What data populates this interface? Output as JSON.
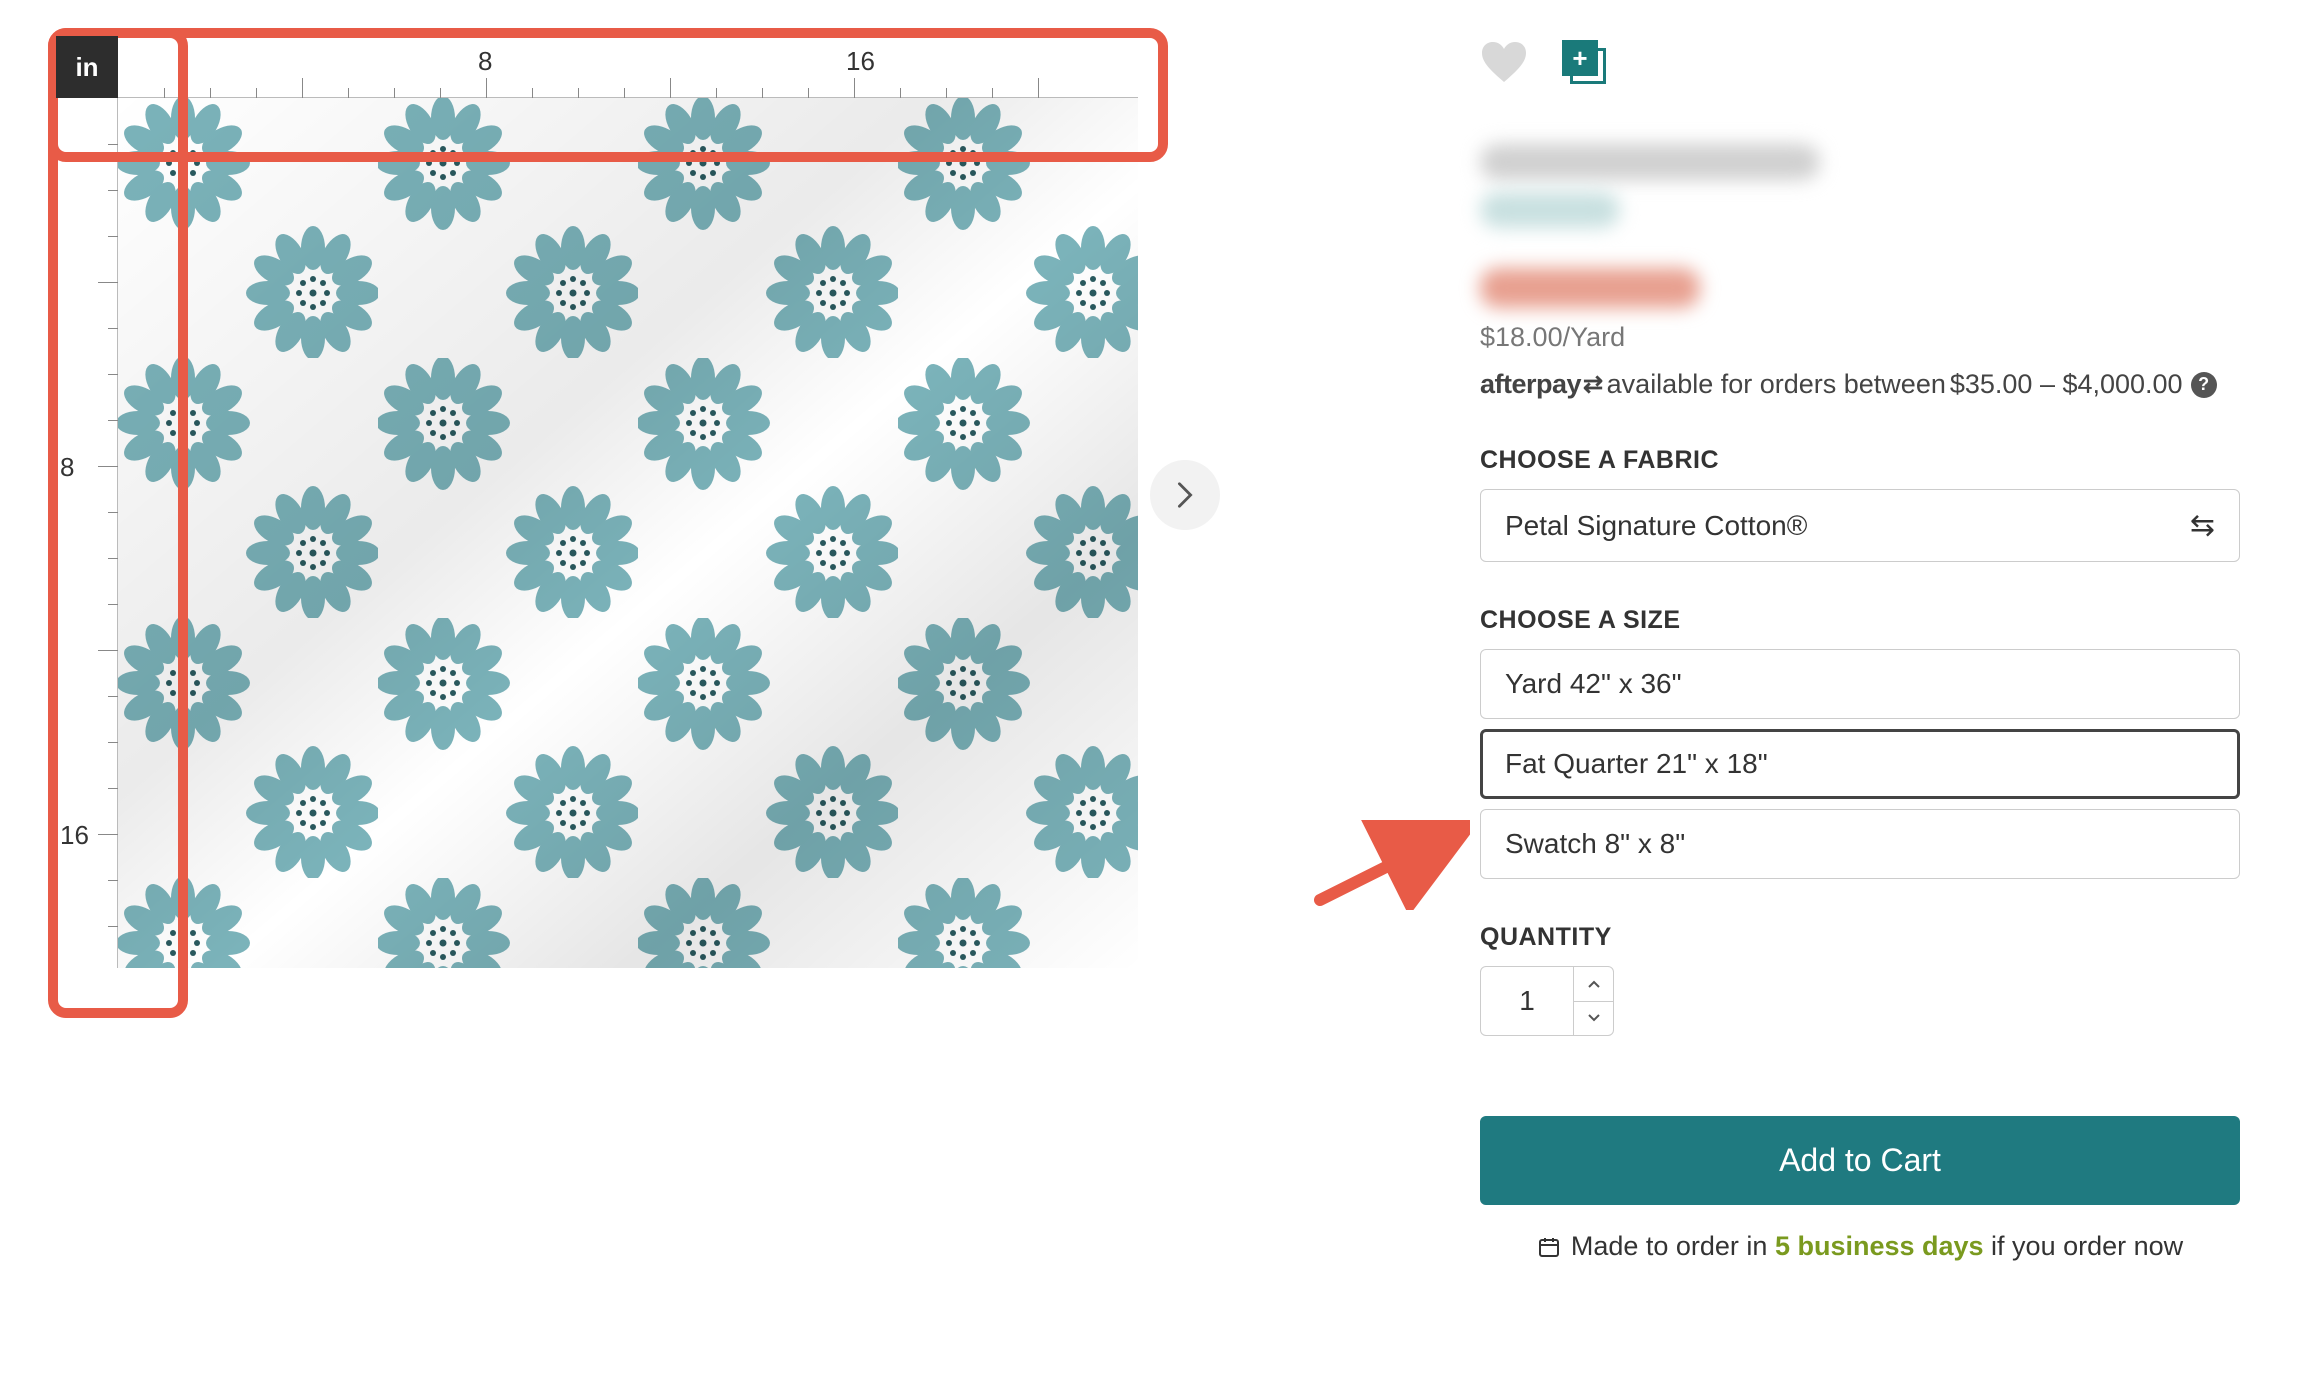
{
  "ruler": {
    "unit_label": "in",
    "h_numbers": [
      "8",
      "16"
    ],
    "v_numbers": [
      "8",
      "16"
    ]
  },
  "pricing": {
    "price_per_yard": "$18.00/Yard",
    "afterpay_brand": "afterpay",
    "afterpay_text_1": "available for orders between ",
    "afterpay_range": "$35.00 – $4,000.00"
  },
  "fabric_section": {
    "label": "CHOOSE A FABRIC",
    "selected": "Petal Signature Cotton®"
  },
  "size_section": {
    "label": "CHOOSE A SIZE",
    "options": [
      {
        "label": "Yard 42\" x 36\"",
        "selected": false
      },
      {
        "label": "Fat Quarter 21\" x 18\"",
        "selected": true
      },
      {
        "label": "Swatch 8\" x 8\"",
        "selected": false
      }
    ]
  },
  "quantity": {
    "label": "QUANTITY",
    "value": "1"
  },
  "cart": {
    "button": "Add to Cart",
    "made_prefix": "Made to order in ",
    "made_days": "5 business days",
    "made_suffix": " if you order now"
  }
}
